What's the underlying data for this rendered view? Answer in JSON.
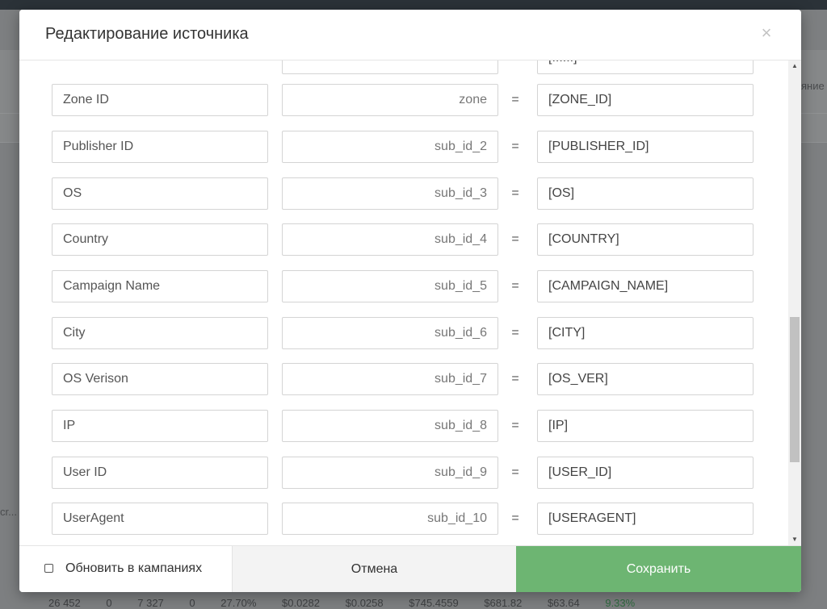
{
  "background": {
    "right_fragment": "яние",
    "left_fragment": "cr...",
    "bottom_row": [
      "26 452",
      "0",
      "7 327",
      "0",
      "27.70%",
      "$0.0282",
      "$0.0258",
      "$745.4559",
      "$681.82",
      "$63.64",
      "9.33%"
    ]
  },
  "modal": {
    "title": "Редактирование источника",
    "close_glyph": "×",
    "rows": [
      {
        "name": "",
        "param": "",
        "value": "[......]"
      },
      {
        "name": "Zone ID",
        "param": "zone",
        "value": "[ZONE_ID]"
      },
      {
        "name": "Publisher ID",
        "param": "sub_id_2",
        "value": "[PUBLISHER_ID]"
      },
      {
        "name": "OS",
        "param": "sub_id_3",
        "value": "[OS]"
      },
      {
        "name": "Country",
        "param": "sub_id_4",
        "value": "[COUNTRY]"
      },
      {
        "name": "Campaign Name",
        "param": "sub_id_5",
        "value": "[CAMPAIGN_NAME]"
      },
      {
        "name": "City",
        "param": "sub_id_6",
        "value": "[CITY]"
      },
      {
        "name": "OS Verison",
        "param": "sub_id_7",
        "value": "[OS_VER]"
      },
      {
        "name": "IP",
        "param": "sub_id_8",
        "value": "[IP]"
      },
      {
        "name": "User ID",
        "param": "sub_id_9",
        "value": "[USER_ID]"
      },
      {
        "name": "UserAgent",
        "param": "sub_id_10",
        "value": "[USERAGENT]"
      }
    ],
    "equals": "="
  },
  "footer": {
    "checkbox_label": "Обновить в кампаниях",
    "checkbox_checked": false,
    "cancel_label": "Отмена",
    "save_label": "Сохранить"
  },
  "colors": {
    "save": "#6db572",
    "cancel": "#f3f3f3"
  }
}
